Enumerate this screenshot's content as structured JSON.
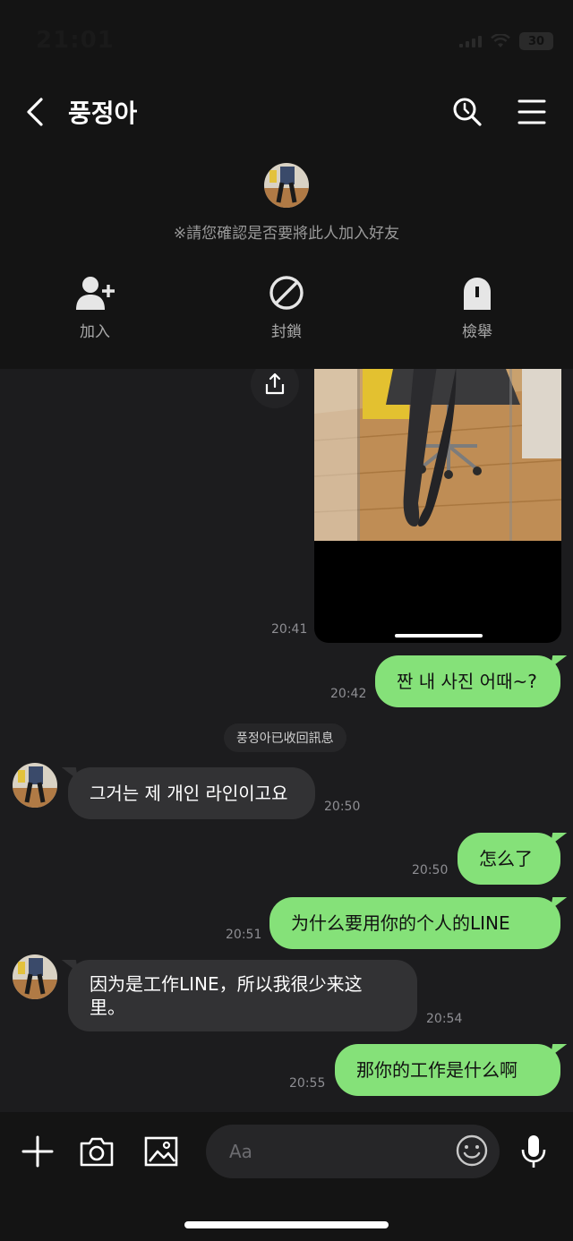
{
  "status_bar": {
    "time": "21:01",
    "battery": "30"
  },
  "header": {
    "title": "풍정아",
    "back_icon": "chevron-left-icon",
    "search_icon": "search-icon",
    "menu_icon": "hamburger-menu-icon"
  },
  "profile": {
    "confirm_text": "※請您確認是否要將此人加入好友"
  },
  "actions": [
    {
      "label": "加入",
      "icon": "add-friend-icon"
    },
    {
      "label": "封鎖",
      "icon": "block-icon"
    },
    {
      "label": "檢舉",
      "icon": "report-icon"
    }
  ],
  "messages": {
    "photo_time": "20:41",
    "m1": {
      "text": "짠 내 사진 어때~?",
      "time": "20:42"
    },
    "recall_notice": "풍정아已收回訊息",
    "m2": {
      "text": "그거는 제 개인 라인이고요",
      "time": "20:50"
    },
    "m3": {
      "text": "怎么了",
      "time": "20:50"
    },
    "m4": {
      "text": "为什么要用你的个人的LINE",
      "time": "20:51"
    },
    "m5": {
      "line1": "因为是工作LINE，所以我很少来这",
      "line2": "里。",
      "time": "20:54"
    },
    "m6": {
      "text": "那你的工作是什么啊",
      "time": "20:55"
    }
  },
  "input_bar": {
    "placeholder": "Aa",
    "icons": [
      "plus-icon",
      "camera-icon",
      "image-icon",
      "emoji-icon",
      "microphone-icon"
    ]
  },
  "colors": {
    "outgoing_bubble": "#85e179",
    "incoming_bubble": "#323234",
    "background": "#1c1c1e",
    "header_bg": "#141414"
  }
}
